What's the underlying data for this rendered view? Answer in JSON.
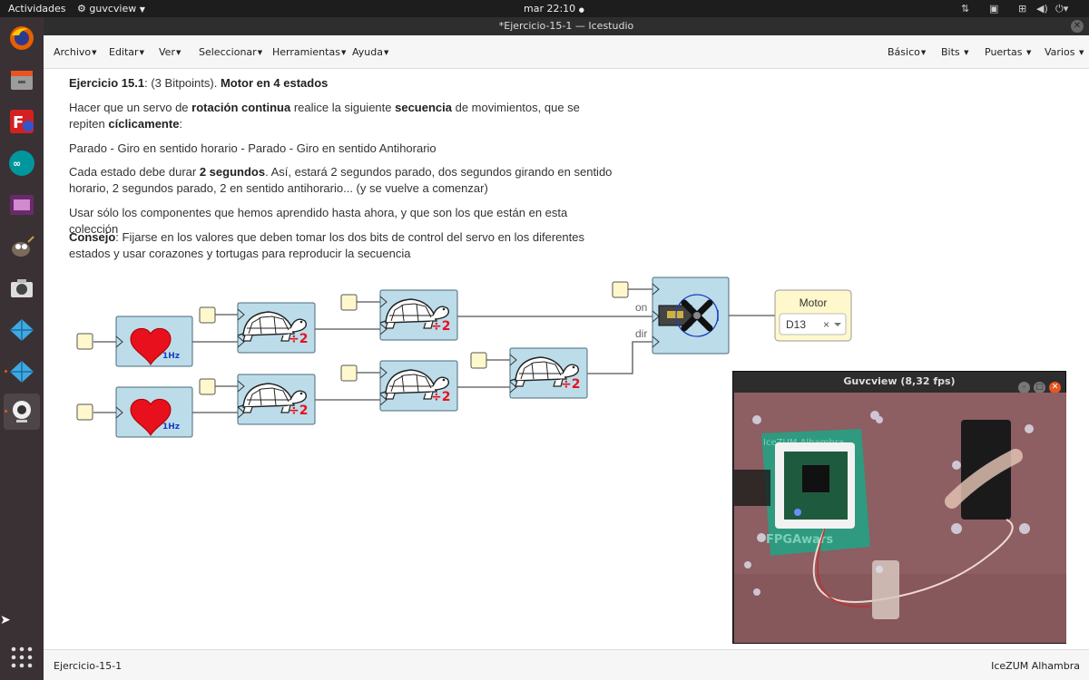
{
  "topbar": {
    "activities": "Actividades",
    "app": "guvcview",
    "clock": "mar 22:10"
  },
  "window": {
    "title": "*Ejercicio-15-1 — Icestudio"
  },
  "menubar": {
    "left": [
      "Archivo",
      "Editar",
      "Ver",
      "Seleccionar",
      "Herramientas",
      "Ayuda"
    ],
    "right": [
      "Básico",
      "Bits",
      "Puertas",
      "Varios"
    ]
  },
  "content": {
    "p1": {
      "a": "Ejercicio 15.1",
      "b": ": (3 Bitpoints). ",
      "c": "Motor en 4 estados"
    },
    "p2": {
      "a": "Hacer que un servo de ",
      "b": "rotación continua",
      "c": " realice la siguiente ",
      "d": "secuencia",
      "e": " de movimientos, que se repiten ",
      "f": "cíclicamente",
      "g": ":"
    },
    "p3": "Parado - Giro en sentido horario - Parado - Giro en sentido Antihorario",
    "p4": {
      "a": "Cada estado debe durar ",
      "b": "2 segundos",
      "c": ". Así, estará 2 segundos parado, dos segundos girando en sentido horario, 2 segundos parado, 2 en sentido antihorario... (y se vuelve a comenzar)"
    },
    "p5": "Usar sólo los componentes que hemos aprendido hasta ahora, y que son los que están en esta colección",
    "p6": {
      "a": "Consejo",
      "b": ": Fijarse en los valores que deben tomar los dos bits de control del servo en los diferentes estados y usar corazones y tortugas para reproducir la secuencia"
    }
  },
  "circuit": {
    "heart_label": "1Hz",
    "turtle_label": "÷2",
    "servo_inputs": [
      "on",
      "dir"
    ],
    "output": {
      "title": "Motor",
      "pin": "D13",
      "clear": "×"
    }
  },
  "guvcview": {
    "title": "Guvcview  (8,32 fps)",
    "board_text": "FPGAwars",
    "board_label": "IceZUM Alhambra"
  },
  "statusbar": {
    "left": "Ejercicio-15-1",
    "right": "IceZUM Alhambra"
  }
}
